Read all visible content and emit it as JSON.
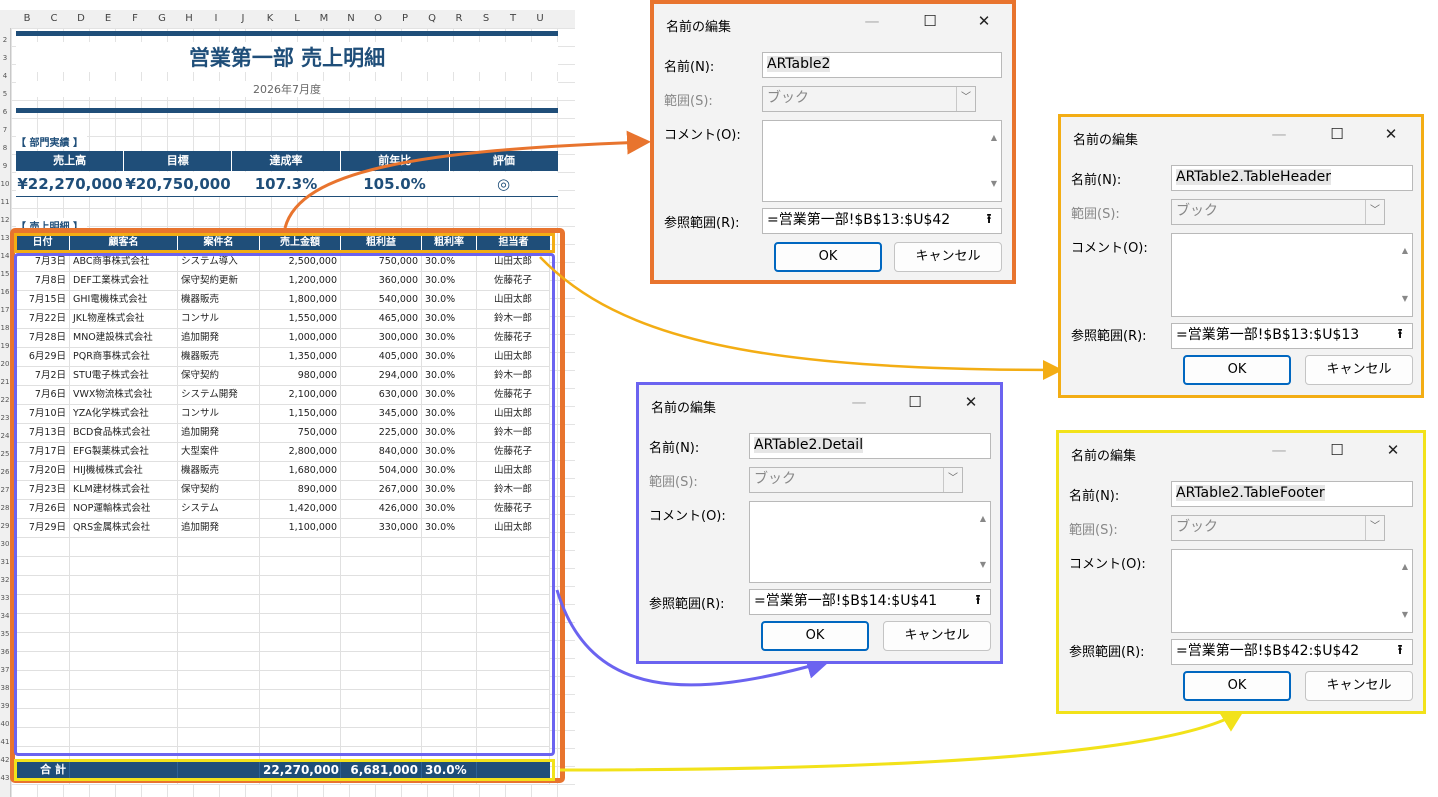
{
  "columns": [
    "B",
    "C",
    "D",
    "E",
    "F",
    "G",
    "H",
    "I",
    "J",
    "K",
    "L",
    "M",
    "N",
    "O",
    "P",
    "Q",
    "R",
    "S",
    "T",
    "U"
  ],
  "row_numbers": [
    "2",
    "3",
    "4",
    "5",
    "6",
    "7",
    "8",
    "9",
    "10",
    "11",
    "12",
    "13",
    "14",
    "15",
    "16",
    "17",
    "18",
    "19",
    "20",
    "21",
    "22",
    "23",
    "24",
    "25",
    "26",
    "27",
    "28",
    "29",
    "30",
    "31",
    "32",
    "33",
    "34",
    "35",
    "36",
    "37",
    "38",
    "39",
    "40",
    "41",
    "42",
    "43"
  ],
  "sheet": {
    "title": "営業第一部 売上明細",
    "subtitle": "2026年7月度",
    "kpi_section": "【 部門実績 】",
    "kpi_headers": [
      "売上高",
      "目標",
      "達成率",
      "前年比",
      "評価"
    ],
    "kpi_values": [
      "¥22,270,000",
      "¥20,750,000",
      "107.3%",
      "105.0%",
      "◎"
    ],
    "detail_section": "【 売上明細 】",
    "table_headers": [
      "日付",
      "顧客名",
      "案件名",
      "売上金額",
      "粗利益",
      "粗利率",
      "担当者"
    ],
    "rows": [
      [
        "7月3日",
        "ABC商事株式会社",
        "システム導入",
        "2,500,000",
        "750,000",
        "30.0%",
        "山田太郎"
      ],
      [
        "7月8日",
        "DEF工業株式会社",
        "保守契約更新",
        "1,200,000",
        "360,000",
        "30.0%",
        "佐藤花子"
      ],
      [
        "7月15日",
        "GHI電機株式会社",
        "機器販売",
        "1,800,000",
        "540,000",
        "30.0%",
        "山田太郎"
      ],
      [
        "7月22日",
        "JKL物産株式会社",
        "コンサル",
        "1,550,000",
        "465,000",
        "30.0%",
        "鈴木一郎"
      ],
      [
        "7月28日",
        "MNO建設株式会社",
        "追加開発",
        "1,000,000",
        "300,000",
        "30.0%",
        "佐藤花子"
      ],
      [
        "6月29日",
        "PQR商事株式会社",
        "機器販売",
        "1,350,000",
        "405,000",
        "30.0%",
        "山田太郎"
      ],
      [
        "7月2日",
        "STU電子株式会社",
        "保守契約",
        "980,000",
        "294,000",
        "30.0%",
        "鈴木一郎"
      ],
      [
        "7月6日",
        "VWX物流株式会社",
        "システム開発",
        "2,100,000",
        "630,000",
        "30.0%",
        "佐藤花子"
      ],
      [
        "7月10日",
        "YZA化学株式会社",
        "コンサル",
        "1,150,000",
        "345,000",
        "30.0%",
        "山田太郎"
      ],
      [
        "7月13日",
        "BCD食品株式会社",
        "追加開発",
        "750,000",
        "225,000",
        "30.0%",
        "鈴木一郎"
      ],
      [
        "7月17日",
        "EFG製薬株式会社",
        "大型案件",
        "2,800,000",
        "840,000",
        "30.0%",
        "佐藤花子"
      ],
      [
        "7月20日",
        "HIJ機械株式会社",
        "機器販売",
        "1,680,000",
        "504,000",
        "30.0%",
        "山田太郎"
      ],
      [
        "7月23日",
        "KLM建材株式会社",
        "保守契約",
        "890,000",
        "267,000",
        "30.0%",
        "鈴木一郎"
      ],
      [
        "7月26日",
        "NOP運輸株式会社",
        "システム",
        "1,420,000",
        "426,000",
        "30.0%",
        "佐藤花子"
      ],
      [
        "7月29日",
        "QRS金属株式会社",
        "追加開発",
        "1,100,000",
        "330,000",
        "30.0%",
        "山田太郎"
      ]
    ],
    "footer": {
      "label": "合 計",
      "sales": "22,270,000",
      "profit": "6,681,000",
      "rate": "30.0%"
    }
  },
  "dialog_common": {
    "title": "名前の編集",
    "name_label": "名前(N):",
    "scope_label": "範囲(S):",
    "scope_value": "ブック",
    "comment_label": "コメント(O):",
    "ref_label": "参照範囲(R):",
    "ok": "OK",
    "cancel": "キャンセル",
    "minimize": "—",
    "maximize": "☐",
    "close": "✕"
  },
  "dialogs": [
    {
      "name": "ARTable2",
      "ref": "=営業第一部!$B$13:$U$42",
      "border": "#e8742e"
    },
    {
      "name": "ARTable2.TableHeader",
      "ref": "=営業第一部!$B$13:$U$13",
      "border": "#f3ad14"
    },
    {
      "name": "ARTable2.Detail",
      "ref": "=営業第一部!$B$14:$U$41",
      "border": "#6b63f0"
    },
    {
      "name": "ARTable2.TableFooter",
      "ref": "=営業第一部!$B$42:$U$42",
      "border": "#f2e21a"
    }
  ]
}
